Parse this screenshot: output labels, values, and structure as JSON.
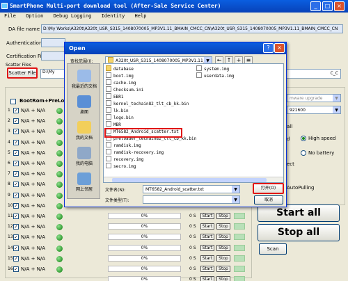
{
  "window": {
    "title": "SmartPhone Multi-port download tool (After-Sale Service Center)",
    "min": "_",
    "max": "□",
    "close": "×"
  },
  "menu": [
    "File",
    "Option",
    "Debug Logging",
    "Identity",
    "Help"
  ],
  "fields": {
    "da_label": "DA file name",
    "da_value": "D:\\My Works\\A320t\\A320t_USR_S315_1408070005_MP3V1.11_BMAIN_CMCC_CN\\A320t_USR_S315_1408070005_MP3V1.11_BMAIN_CMCC_CN",
    "auth_label": "Authentication file",
    "cert_label": "Certification File",
    "scatter_group": "Scatter Files",
    "scatter_button": "Scatter File",
    "scatter_value": "D:\\My"
  },
  "ports": {
    "header": "BootRom+PreLoade",
    "rows": [
      {
        "num": "1",
        "label": "N/A + N/A"
      },
      {
        "num": "2",
        "label": "N/A + N/A"
      },
      {
        "num": "3",
        "label": "N/A + N/A"
      },
      {
        "num": "4",
        "label": "N/A + N/A"
      },
      {
        "num": "5",
        "label": "N/A + N/A"
      },
      {
        "num": "6",
        "label": "N/A + N/A"
      },
      {
        "num": "7",
        "label": "N/A + N/A"
      },
      {
        "num": "8",
        "label": "N/A + N/A"
      },
      {
        "num": "9",
        "label": "N/A + N/A"
      },
      {
        "num": "10",
        "label": "N/A + N/A"
      },
      {
        "num": "11",
        "label": "N/A + N/A"
      },
      {
        "num": "12",
        "label": "N/A + N/A"
      },
      {
        "num": "13",
        "label": "N/A + N/A"
      },
      {
        "num": "14",
        "label": "N/A + N/A"
      },
      {
        "num": "15",
        "label": "N/A + N/A"
      },
      {
        "num": "16",
        "label": "N/A + N/A"
      }
    ],
    "visible_progress": [
      {
        "percent": "0%",
        "time": "0 S",
        "start": "Start",
        "stop": "Stop"
      },
      {
        "percent": "0%",
        "time": "0 S",
        "start": "Start",
        "stop": "Stop"
      },
      {
        "percent": "0%",
        "time": "0 S",
        "start": "Start",
        "stop": "Stop"
      },
      {
        "percent": "0%",
        "time": "0 S",
        "start": "Start",
        "stop": "Stop"
      },
      {
        "percent": "0%",
        "time": "0 S",
        "start": "Start",
        "stop": "Stop"
      },
      {
        "percent": "0%",
        "time": "0 S",
        "start": "Start",
        "stop": "Stop"
      },
      {
        "percent": "0%",
        "time": "0 S",
        "start": "Start",
        "stop": "Stop"
      }
    ]
  },
  "right_panel": {
    "mode_select": "mware upgrade",
    "baud_select": "921600",
    "all_label": "all",
    "speed_label": "d",
    "high_speed": "High speed",
    "no_battery": "No battery",
    "ect_label": "ect",
    "autopulling": "AutoPulling",
    "start_all": "Start all",
    "stop_all": "Stop all",
    "scan": "Scan",
    "cmcc_text": "C_C"
  },
  "dialog": {
    "title": "Open",
    "help": "?",
    "close": "×",
    "lookin_label": "查找范围(I):",
    "lookin_value": "A320t_USR_S315_1408070005_MP3V1.11_B",
    "places": [
      "我最近的文档",
      "桌面",
      "我的文档",
      "我的电脑",
      "网上邻居"
    ],
    "files_left": [
      {
        "name": "database",
        "type": "folder"
      },
      {
        "name": "boot.img",
        "type": "file"
      },
      {
        "name": "cache.img",
        "type": "file"
      },
      {
        "name": "Checksum.ini",
        "type": "file"
      },
      {
        "name": "EBR1",
        "type": "file"
      },
      {
        "name": "kernel_techain82_tlt_cb_kk.bin",
        "type": "file"
      },
      {
        "name": "lk.bin",
        "type": "file"
      },
      {
        "name": "logo.bin",
        "type": "file"
      },
      {
        "name": "MBR",
        "type": "file"
      },
      {
        "name": "MT6582_Android_scatter.txt",
        "type": "file"
      },
      {
        "name": "preloader_techain82_tlt_cb_kk.bin",
        "type": "file"
      },
      {
        "name": "ramdisk.img",
        "type": "file"
      },
      {
        "name": "ramdisk-recovery.img",
        "type": "file"
      },
      {
        "name": "recovery.img",
        "type": "file"
      },
      {
        "name": "secro.img",
        "type": "file"
      }
    ],
    "files_right": [
      {
        "name": "system.img",
        "type": "file"
      },
      {
        "name": "userdata.img",
        "type": "file"
      }
    ],
    "filename_label": "文件名(N):",
    "filename_value": "MT6582_Android_scatter.txt",
    "filetype_label": "文件类型(T):",
    "filetype_value": "",
    "open_button": "打开(O)",
    "cancel_button": "取消"
  },
  "colors": {
    "highlight_red": "#e01414",
    "title_blue": "#0a5ee0",
    "selection_blue": "#316ac5",
    "led_green": "#0a7d0a"
  }
}
